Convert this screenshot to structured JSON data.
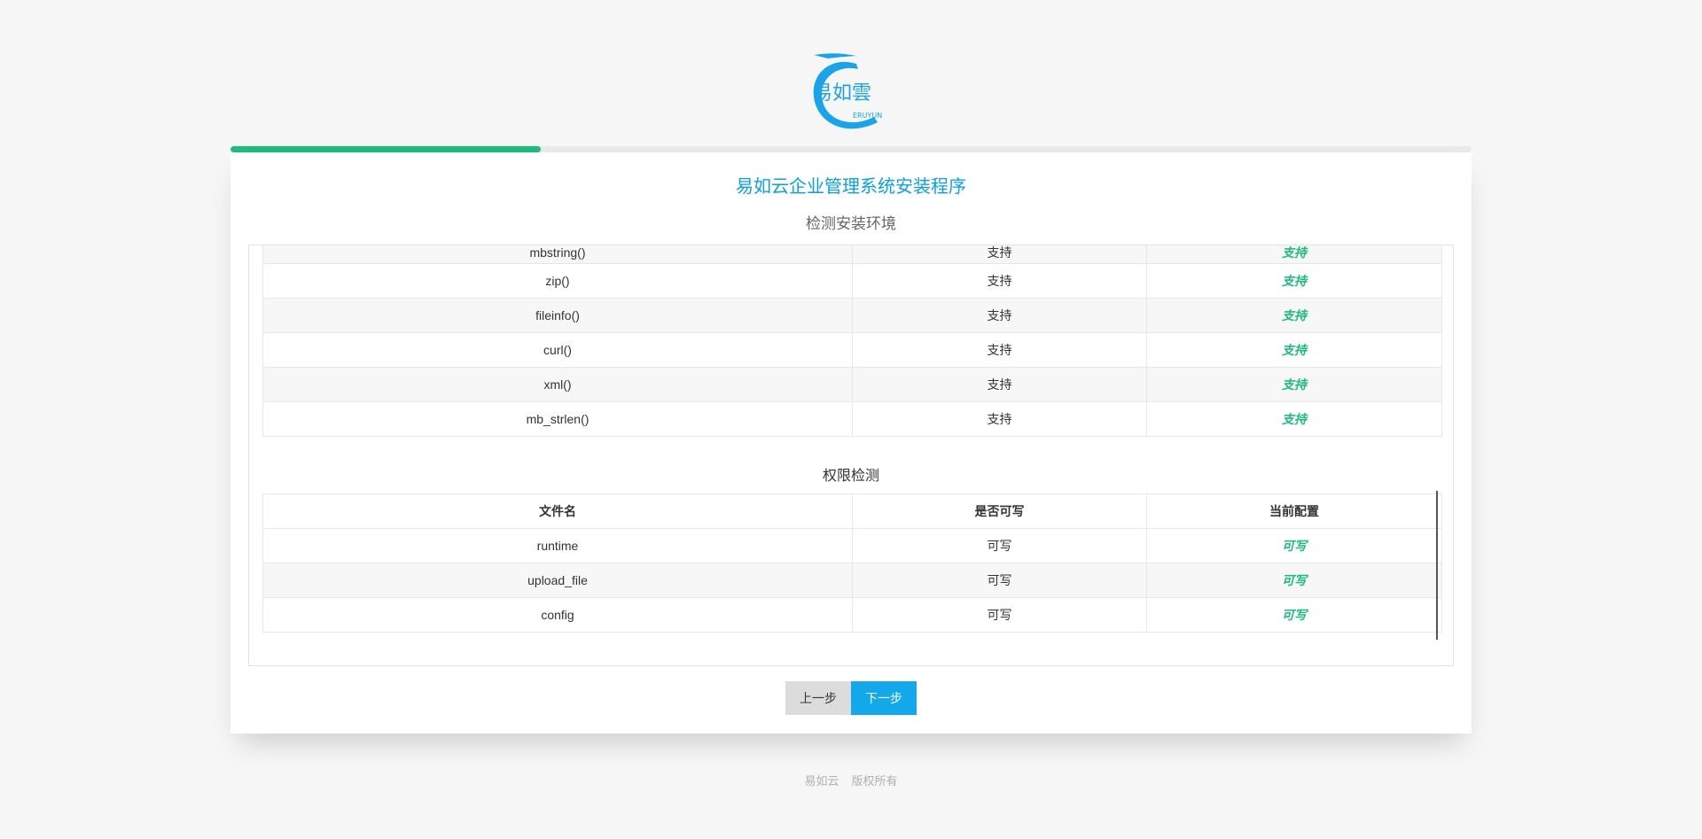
{
  "logo": {
    "text": "易如雲",
    "brand": "ERUYUN",
    "color": "#1aa3ea"
  },
  "progress": {
    "percent": 25,
    "color": "#1dbc7c"
  },
  "header": {
    "title": "易如云企业管理系统安装程序",
    "subtitle": "检测安装环境"
  },
  "function_check": {
    "rows": [
      {
        "name": "mbstring()",
        "required": "支持",
        "current": "支持"
      },
      {
        "name": "zip()",
        "required": "支持",
        "current": "支持"
      },
      {
        "name": "fileinfo()",
        "required": "支持",
        "current": "支持"
      },
      {
        "name": "curl()",
        "required": "支持",
        "current": "支持"
      },
      {
        "name": "xml()",
        "required": "支持",
        "current": "支持"
      },
      {
        "name": "mb_strlen()",
        "required": "支持",
        "current": "支持"
      }
    ]
  },
  "permission_check": {
    "title": "权限检测",
    "headers": [
      "文件名",
      "是否可写",
      "当前配置"
    ],
    "rows": [
      {
        "name": "runtime",
        "required": "可写",
        "current": "可写"
      },
      {
        "name": "upload_file",
        "required": "可写",
        "current": "可写"
      },
      {
        "name": "config",
        "required": "可写",
        "current": "可写"
      }
    ]
  },
  "buttons": {
    "prev": "上一步",
    "next": "下一步"
  },
  "footer": {
    "company": "易如云",
    "rights": "版权所有"
  }
}
